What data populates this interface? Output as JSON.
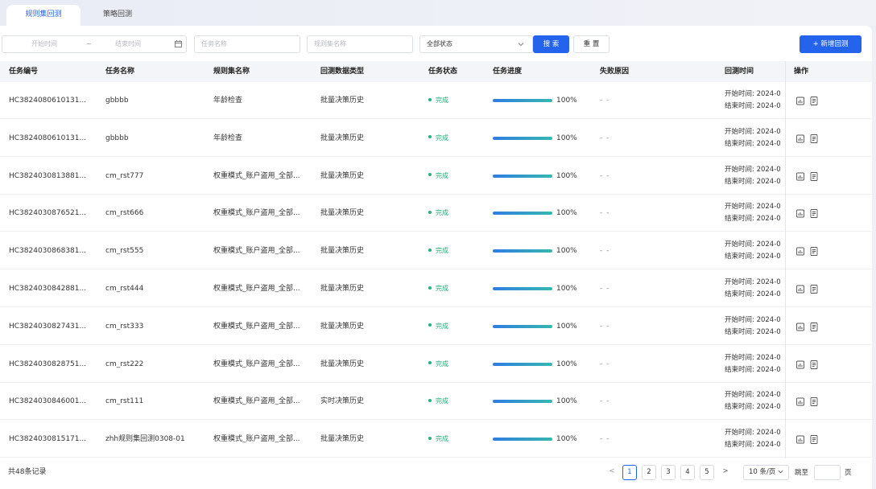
{
  "tabs": [
    {
      "label": "规则集回测",
      "active": true
    },
    {
      "label": "策略回测",
      "active": false
    }
  ],
  "filters": {
    "start_placeholder": "开始时间",
    "range_separator": "~",
    "end_placeholder": "结束时间",
    "task_name_placeholder": "任务名称",
    "rule_name_placeholder": "规则集名称",
    "status_value": "全部状态",
    "search_label": "搜 索",
    "reset_label": "重 置",
    "add_label": "+ 新增回测"
  },
  "columns": [
    "任务编号",
    "任务名称",
    "规则集名称",
    "回测数据类型",
    "任务状态",
    "任务进度",
    "失败原因",
    "回测时间",
    "操作"
  ],
  "rows": [
    {
      "id": "HC3824080610131...",
      "name": "gbbbb",
      "rule": "年龄检查",
      "type": "批量决策历史",
      "status": "完成",
      "progress": "100%",
      "progress_value": 1.0,
      "fail": "- -",
      "start": "开始时间: 2024-0",
      "end": "结束时间: 2024-0"
    },
    {
      "id": "HC3824080610131...",
      "name": "gbbbb",
      "rule": "年龄检查",
      "type": "批量决策历史",
      "status": "完成",
      "progress": "100%",
      "progress_value": 1.0,
      "fail": "- -",
      "start": "开始时间: 2024-0",
      "end": "结束时间: 2024-0"
    },
    {
      "id": "HC3824030813881...",
      "name": "cm_rst777",
      "rule": "权重模式_账户盗用_全部...",
      "type": "批量决策历史",
      "status": "完成",
      "progress": "100%",
      "progress_value": 1.0,
      "fail": "- -",
      "start": "开始时间: 2024-0",
      "end": "结束时间: 2024-0"
    },
    {
      "id": "HC3824030876521...",
      "name": "cm_rst666",
      "rule": "权重模式_账户盗用_全部...",
      "type": "批量决策历史",
      "status": "完成",
      "progress": "100%",
      "progress_value": 1.0,
      "fail": "- -",
      "start": "开始时间: 2024-0",
      "end": "结束时间: 2024-0"
    },
    {
      "id": "HC3824030868381...",
      "name": "cm_rst555",
      "rule": "权重模式_账户盗用_全部...",
      "type": "批量决策历史",
      "status": "完成",
      "progress": "100%",
      "progress_value": 1.0,
      "fail": "- -",
      "start": "开始时间: 2024-0",
      "end": "结束时间: 2024-0"
    },
    {
      "id": "HC3824030842881...",
      "name": "cm_rst444",
      "rule": "权重模式_账户盗用_全部...",
      "type": "批量决策历史",
      "status": "完成",
      "progress": "100%",
      "progress_value": 1.0,
      "fail": "- -",
      "start": "开始时间: 2024-0",
      "end": "结束时间: 2024-0"
    },
    {
      "id": "HC3824030827431...",
      "name": "cm_rst333",
      "rule": "权重模式_账户盗用_全部...",
      "type": "批量决策历史",
      "status": "完成",
      "progress": "100%",
      "progress_value": 1.0,
      "fail": "- -",
      "start": "开始时间: 2024-0",
      "end": "结束时间: 2024-0"
    },
    {
      "id": "HC3824030828751...",
      "name": "cm_rst222",
      "rule": "权重模式_账户盗用_全部...",
      "type": "批量决策历史",
      "status": "完成",
      "progress": "100%",
      "progress_value": 1.0,
      "fail": "- -",
      "start": "开始时间: 2024-0",
      "end": "结束时间: 2024-0"
    },
    {
      "id": "HC3824030846001...",
      "name": "cm_rst111",
      "rule": "权重模式_账户盗用_全部...",
      "type": "实时决策历史",
      "status": "完成",
      "progress": "100%",
      "progress_value": 1.0,
      "fail": "- -",
      "start": "开始时间: 2024-0",
      "end": "结束时间: 2024-0"
    },
    {
      "id": "HC3824030815171...",
      "name": "zhh规则集回测0308-01",
      "rule": "权重模式_账户盗用_全部...",
      "type": "批量决策历史",
      "status": "完成",
      "progress": "100%",
      "progress_value": 1.0,
      "fail": "- -",
      "start": "开始时间: 2024-0",
      "end": "结束时间: 2024-0"
    }
  ],
  "footer": {
    "total": "共48条记录",
    "prev": "<",
    "pages": [
      "1",
      "2",
      "3",
      "4",
      "5"
    ],
    "current_page": "1",
    "next": ">",
    "page_size": "10 条/页",
    "goto_label": "跳至",
    "page_label": "页"
  },
  "colors": {
    "primary": "#2463eb",
    "success": "#28b07a",
    "progress_start": "#2f7de1",
    "progress_end": "#36b8b0"
  },
  "icons": [
    "calendar-icon",
    "chevron-down-icon",
    "chart-icon",
    "document-icon"
  ]
}
